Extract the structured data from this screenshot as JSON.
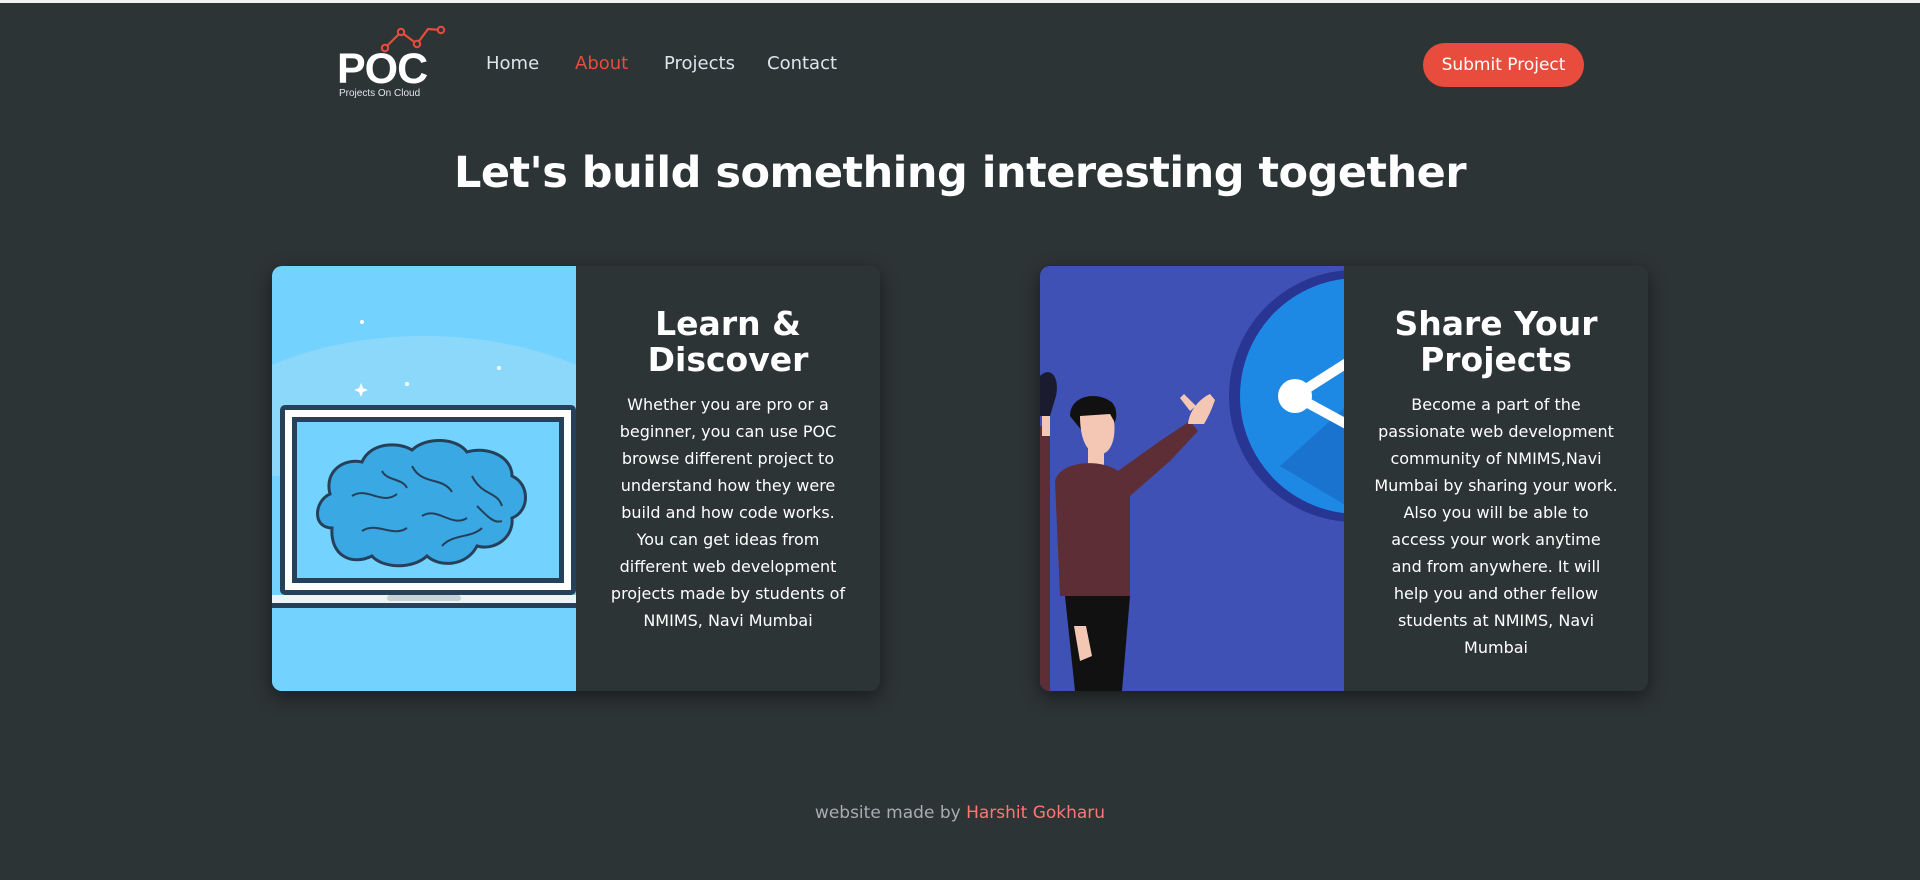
{
  "brand": {
    "logo_text": "POC",
    "logo_subtitle": "Projects On Cloud"
  },
  "nav": {
    "items": [
      {
        "label": "Home",
        "active": false
      },
      {
        "label": "About",
        "active": true
      },
      {
        "label": "Projects",
        "active": false
      },
      {
        "label": "Contact",
        "active": false
      }
    ],
    "cta_label": "Submit Project"
  },
  "hero": {
    "title": "Let's build something interesting together"
  },
  "cards": [
    {
      "title": "Learn & Discover",
      "text": "Whether you are pro or a beginner, you can use POC browse different project to understand how they were build and how code works. You can get ideas from different web development projects made by students of NMIMS, Navi Mumbai",
      "illustration": "laptop-brain-illustration"
    },
    {
      "title": "Share Your Projects",
      "text": "Become a part of the passionate web development community of NMIMS,Navi Mumbai by sharing your work. Also you will be able to access your work anytime and from anywhere. It will help you and other fellow students at NMIMS, Navi Mumbai",
      "illustration": "people-share-illustration"
    }
  ],
  "footer": {
    "prefix": "website made by",
    "author": "Harshit Gokharu"
  },
  "colors": {
    "background": "#2d3436",
    "accent": "#e74c3c",
    "footer_link": "#ff7675"
  }
}
